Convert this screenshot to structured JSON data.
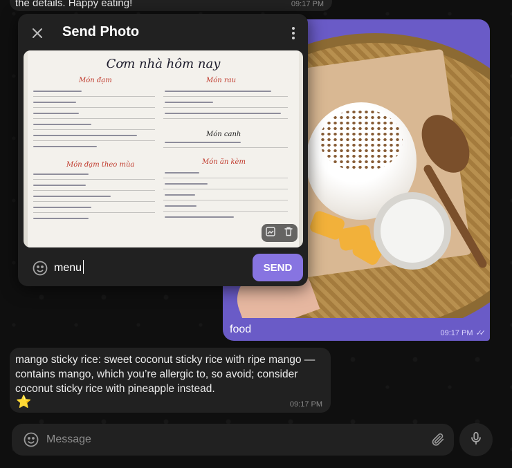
{
  "chat": {
    "top_message": {
      "text": "the details. Happy eating!",
      "time": "09:17 PM"
    },
    "photo_message": {
      "caption": "food",
      "time": "09:17 PM"
    },
    "reply_message": {
      "text": "mango sticky rice: sweet coconut sticky rice with ripe mango — contains mango, which you’re allergic to, so avoid; consider coconut sticky rice with pineapple instead.",
      "emoji": "⭐",
      "time": "09:17 PM"
    }
  },
  "composer": {
    "placeholder": "Message"
  },
  "send_photo_dialog": {
    "title": "Send Photo",
    "caption_value": "menu",
    "send_label": "SEND",
    "menu_image": {
      "heading": "Cơm nhà hôm nay",
      "sections": [
        "Món đạm",
        "Món rau",
        "Món canh",
        "Món đạm theo mùa",
        "Món ăn kèm"
      ]
    }
  },
  "colors": {
    "accent": "#8774e1",
    "bubble_out": "#6a5bc7",
    "bubble_in": "#212121",
    "background": "#0f0f0f"
  }
}
